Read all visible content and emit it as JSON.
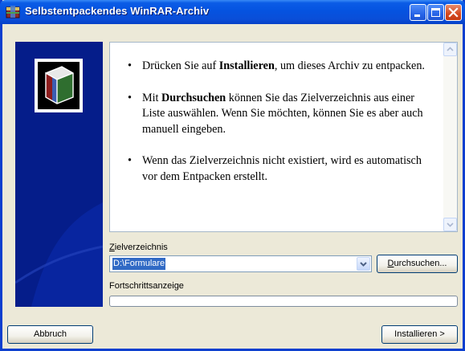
{
  "window": {
    "title": "Selbstentpackendes WinRAR-Archiv",
    "accent": "#0553e0"
  },
  "title_buttons": [
    "minimize-icon",
    "maximize-icon",
    "close-icon"
  ],
  "info": {
    "items": [
      {
        "pre": "Drücken Sie auf ",
        "bold": "Installieren",
        "post": ", um dieses Archiv zu entpacken."
      },
      {
        "pre": "Mit ",
        "bold": "Durchsuchen",
        "post": " können Sie das Zielverzeichnis aus einer Liste auswählen. Wenn Sie möchten, können Sie es aber auch manuell eingeben."
      },
      {
        "pre": "",
        "bold": "",
        "post": "Wenn das Zielverzeichnis nicht existiert, wird es automatisch vor dem Entpacken erstellt."
      }
    ]
  },
  "destination": {
    "label_first": "Z",
    "label_rest": "ielverzeichnis",
    "value": "D:\\Formulare"
  },
  "browse_button": {
    "first": "D",
    "rest": "urchsuchen..."
  },
  "progress": {
    "label": "Fortschrittsanzeige",
    "value": 0
  },
  "buttons": {
    "cancel": "Abbruch",
    "install": "Installieren >"
  }
}
